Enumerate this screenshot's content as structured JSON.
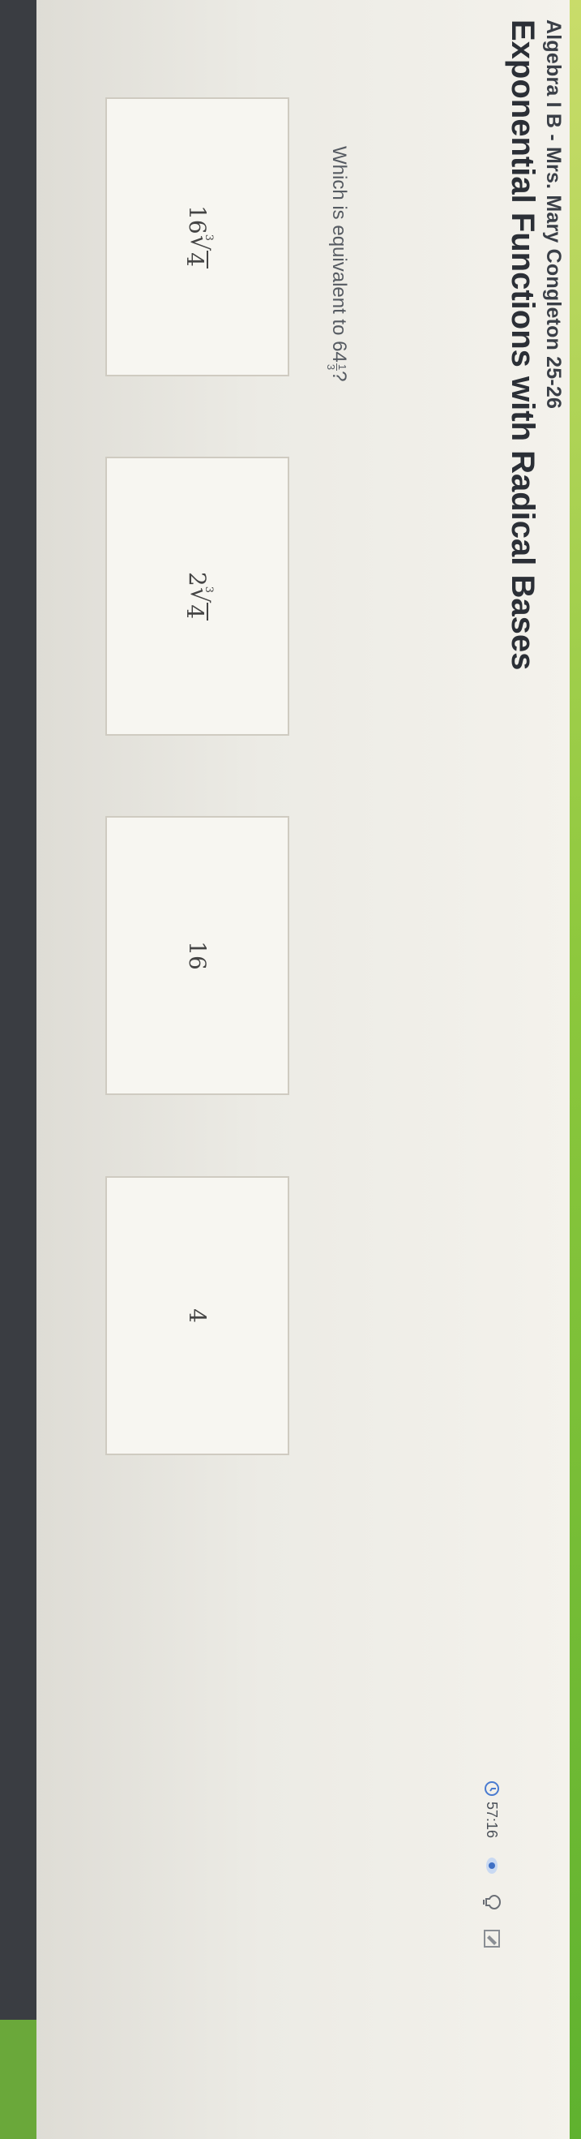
{
  "header": {
    "course": "Algebra I B - Mrs. Mary Congleton 25-26",
    "lesson": "Exponential Functions with Radical Bases"
  },
  "status": {
    "timer": "57:16"
  },
  "question": {
    "prefix": "Which is equivalent to ",
    "base": "64",
    "exp_num": "1",
    "exp_den": "3",
    "suffix": "?"
  },
  "choices": [
    {
      "coefficient": "16",
      "index": "3",
      "radicand": "4"
    },
    {
      "coefficient": "2",
      "index": "3",
      "radicand": "4"
    },
    {
      "text": "16"
    },
    {
      "text": "4"
    }
  ],
  "colors": {
    "accent_green": "#8dc83d",
    "text_dark": "#2b2f36"
  }
}
